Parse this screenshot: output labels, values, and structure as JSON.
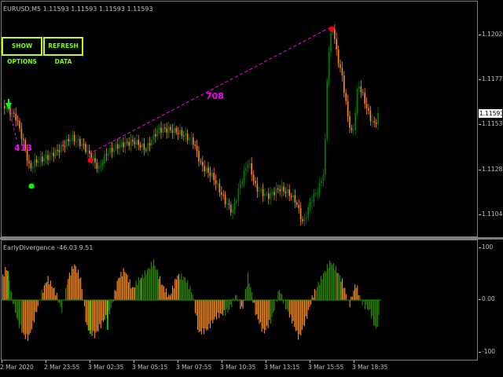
{
  "chart": {
    "title": "EURUSD,M5  1.11593 1.11593 1.11593 1.11593",
    "price_axis": [
      "1.12020",
      "1.11775",
      "1.11530",
      "1.11285",
      "1.11040"
    ],
    "current_price": "1.11593",
    "buttons": {
      "show_options": "SHOW OPTIONS",
      "refresh_data": "REFRESH DATA"
    },
    "divergence_labels": {
      "left": "413",
      "main": "708"
    },
    "colors": {
      "bull_candle": "#008000",
      "bear_candle": "#ff8c1a",
      "divergence_line": "#ff00ff",
      "up_marker": "#00ff00",
      "down_marker": "#ff0000"
    }
  },
  "indicator": {
    "title": "EarlyDivergence -46.03 9.51",
    "axis": [
      "100",
      "0.00",
      "-100"
    ],
    "colors": {
      "positive": "#2e8b00",
      "negative": "#ff8c1a",
      "signal": "#00ff00"
    }
  },
  "time_axis": [
    "2 Mar 2020",
    "2 Mar 23:55",
    "3 Mar 02:35",
    "3 Mar 05:15",
    "3 Mar 07:55",
    "3 Mar 10:35",
    "3 Mar 13:15",
    "3 Mar 15:55",
    "3 Mar 18:35"
  ]
}
